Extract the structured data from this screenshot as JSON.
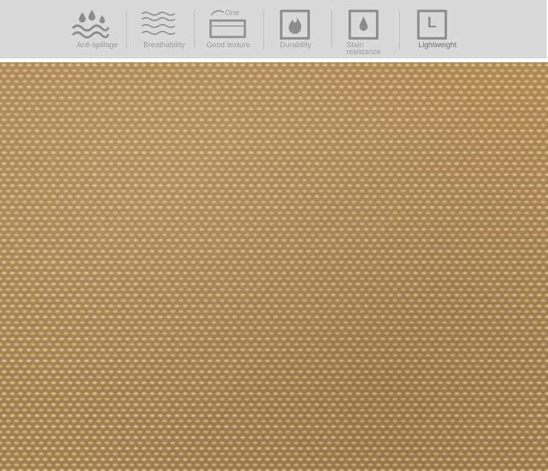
{
  "features": [
    {
      "icon": "water-drops-icon",
      "label": "Anti-spillage"
    },
    {
      "icon": "waves-icon",
      "label": "Breathability"
    },
    {
      "icon": "fabric-layer-icon",
      "label": "Good texture",
      "icon_text": "One"
    },
    {
      "icon": "flame-box-icon",
      "label": "Durability"
    },
    {
      "icon": "drop-box-icon",
      "label_line1": "Stain",
      "label_line2": "resistance"
    },
    {
      "icon": "letter-l-box-icon",
      "label": "Lightweight",
      "icon_text": "L"
    }
  ],
  "colors": {
    "banner_bg": "#d9d9d9",
    "icon_gray": "#8c8c8c",
    "fabric": "#b38f5c"
  }
}
